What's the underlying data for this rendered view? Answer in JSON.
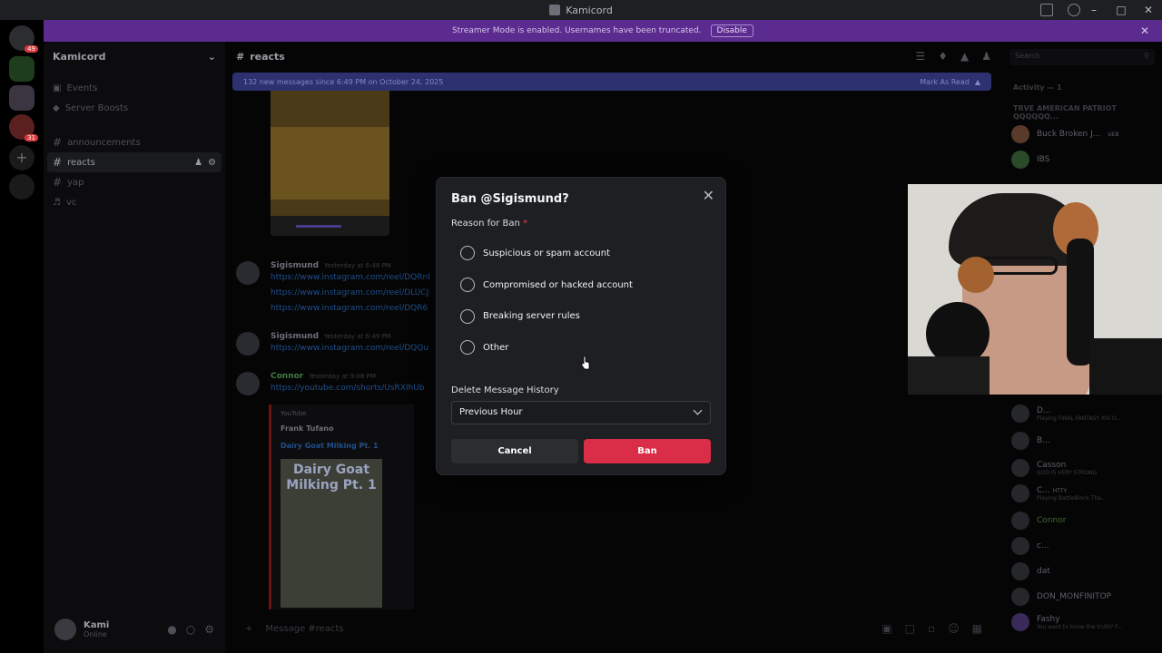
{
  "window": {
    "title": "Kamicord"
  },
  "banner": {
    "text": "Streamer Mode is enabled. Usernames have been truncated.",
    "disable_label": "Disable"
  },
  "rail": {
    "badges": [
      "49",
      "31"
    ]
  },
  "server": {
    "name": "Kamicord"
  },
  "channels": {
    "top": [
      {
        "label": "Events",
        "icon": "calendar-icon"
      },
      {
        "label": "Server Boosts",
        "icon": "boost-icon"
      }
    ],
    "list": [
      {
        "label": "announcements",
        "icon": "hash-icon"
      },
      {
        "label": "reacts",
        "icon": "hash-icon",
        "active": true
      },
      {
        "label": "yap",
        "icon": "hash-icon"
      },
      {
        "label": "vc",
        "icon": "speaker-icon"
      }
    ]
  },
  "user": {
    "name": "Kami",
    "status": "Online"
  },
  "chat": {
    "channel": "reacts",
    "new_messages": "132 new messages since 6:49 PM on October 24, 2025",
    "mark_read": "Mark As Read",
    "messages": [
      {
        "author": "Sigismund",
        "time": "Yesterday at 6:48 PM",
        "links": [
          "https://www.instagram.com/reel/DQRnI",
          "https://www.instagram.com/reel/DLUCJ",
          "https://www.instagram.com/reel/DQR6"
        ]
      },
      {
        "author": "Sigismund",
        "time": "Yesterday at 6:49 PM",
        "links": [
          "https://www.instagram.com/reel/DQQu"
        ]
      },
      {
        "author": "Connor",
        "time": "Yesterday at 9:08 PM",
        "links": [
          "https://youtube.com/shorts/UsRXIhUb"
        ],
        "embed": {
          "provider": "YouTube",
          "author": "Frank Tufano",
          "title": "Dairy Goat Milking Pt. 1",
          "thumb_text": "Dairy Goat Milking Pt. 1"
        }
      }
    ],
    "input_placeholder": "Message #reacts"
  },
  "members": {
    "search_placeholder": "Search",
    "activity_header": "Activity — 1",
    "group_header": "TRVE AMERICAN PATRIOT QQQQQQ...",
    "list": [
      {
        "name": "Buck Broken J...",
        "tag": "UEB"
      },
      {
        "name": "IBS"
      },
      {
        "name": "D...",
        "sub": "Playing FINAL FANTASY XIV O..."
      },
      {
        "name": "B...",
        "sub": ""
      },
      {
        "name": "Casson",
        "sub": "GOD IS VERY STRONG"
      },
      {
        "name": "C...",
        "tag": "HTTY",
        "sub": "Playing BattleBlock Tha..."
      },
      {
        "name": "Connor"
      },
      {
        "name": "c..."
      },
      {
        "name": "dat"
      },
      {
        "name": "DON_MONFINITOP"
      },
      {
        "name": "Fashy",
        "sub": "You want to know the truth? F..."
      }
    ]
  },
  "modal": {
    "title": "Ban @Sigismund?",
    "reason_label": "Reason for Ban",
    "required_marker": "*",
    "reasons": [
      "Suspicious or spam account",
      "Compromised or hacked account",
      "Breaking server rules",
      "Other"
    ],
    "history_label": "Delete Message History",
    "history_value": "Previous Hour",
    "cancel_label": "Cancel",
    "ban_label": "Ban"
  },
  "colors": {
    "ban_button": "#da2d48",
    "banner": "#5c2b8f",
    "new_msg_bar": "#2d3170"
  }
}
